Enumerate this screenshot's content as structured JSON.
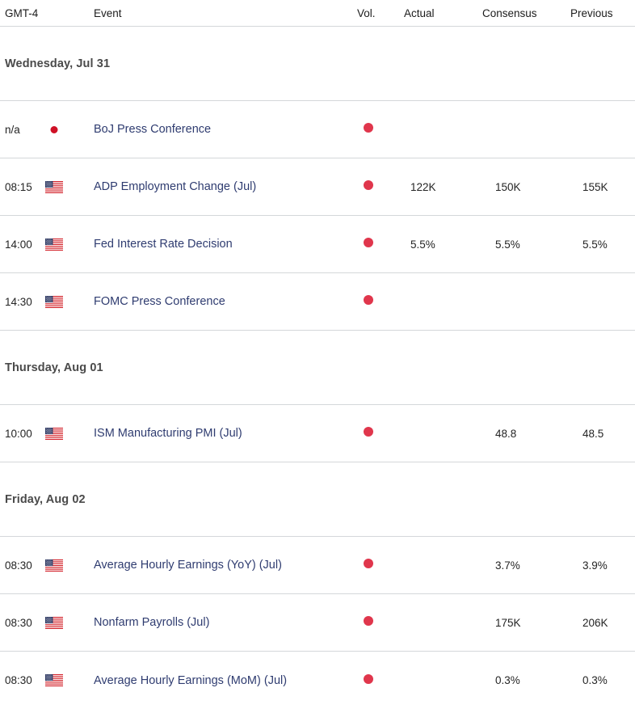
{
  "table": {
    "columns": {
      "time": "GMT-4",
      "event": "Event",
      "vol": "Vol.",
      "actual": "Actual",
      "consensus": "Consensus",
      "previous": "Previous"
    },
    "sections": [
      {
        "date_label": "Wednesday, Jul 31",
        "rows": [
          {
            "time": "n/a",
            "flag": "japan-flag-icon",
            "country": "Japan",
            "event": "BoJ Press Conference",
            "volatility": "high",
            "vol_icon": "volatility-dot-icon",
            "actual": "",
            "consensus": "",
            "previous": ""
          },
          {
            "time": "08:15",
            "flag": "usa-flag-icon",
            "country": "United States",
            "event": "ADP Employment Change (Jul)",
            "volatility": "high",
            "vol_icon": "volatility-dot-icon",
            "actual": "122K",
            "consensus": "150K",
            "previous": "155K"
          },
          {
            "time": "14:00",
            "flag": "usa-flag-icon",
            "country": "United States",
            "event": "Fed Interest Rate Decision",
            "volatility": "high",
            "vol_icon": "volatility-dot-icon",
            "actual": "5.5%",
            "consensus": "5.5%",
            "previous": "5.5%"
          },
          {
            "time": "14:30",
            "flag": "usa-flag-icon",
            "country": "United States",
            "event": "FOMC Press Conference",
            "volatility": "high",
            "vol_icon": "volatility-dot-icon",
            "actual": "",
            "consensus": "",
            "previous": ""
          }
        ]
      },
      {
        "date_label": "Thursday, Aug 01",
        "rows": [
          {
            "time": "10:00",
            "flag": "usa-flag-icon",
            "country": "United States",
            "event": "ISM Manufacturing PMI (Jul)",
            "volatility": "high",
            "vol_icon": "volatility-dot-icon",
            "actual": "",
            "consensus": "48.8",
            "previous": "48.5"
          }
        ]
      },
      {
        "date_label": "Friday, Aug 02",
        "rows": [
          {
            "time": "08:30",
            "flag": "usa-flag-icon",
            "country": "United States",
            "event": "Average Hourly Earnings (YoY) (Jul)",
            "volatility": "high",
            "vol_icon": "volatility-dot-icon",
            "actual": "",
            "consensus": "3.7%",
            "previous": "3.9%"
          },
          {
            "time": "08:30",
            "flag": "usa-flag-icon",
            "country": "United States",
            "event": "Nonfarm Payrolls (Jul)",
            "volatility": "high",
            "vol_icon": "volatility-dot-icon",
            "actual": "",
            "consensus": "175K",
            "previous": "206K"
          },
          {
            "time": "08:30",
            "flag": "usa-flag-icon",
            "country": "United States",
            "event": "Average Hourly Earnings (MoM) (Jul)",
            "volatility": "high",
            "vol_icon": "volatility-dot-icon",
            "actual": "",
            "consensus": "0.3%",
            "previous": "0.3%"
          }
        ]
      }
    ]
  },
  "colors": {
    "event_link": "#2f3c70",
    "volatility_high": "#e0364c",
    "divider": "#d4d7da",
    "date_header": "#4a4a4a",
    "text": "#242424"
  }
}
